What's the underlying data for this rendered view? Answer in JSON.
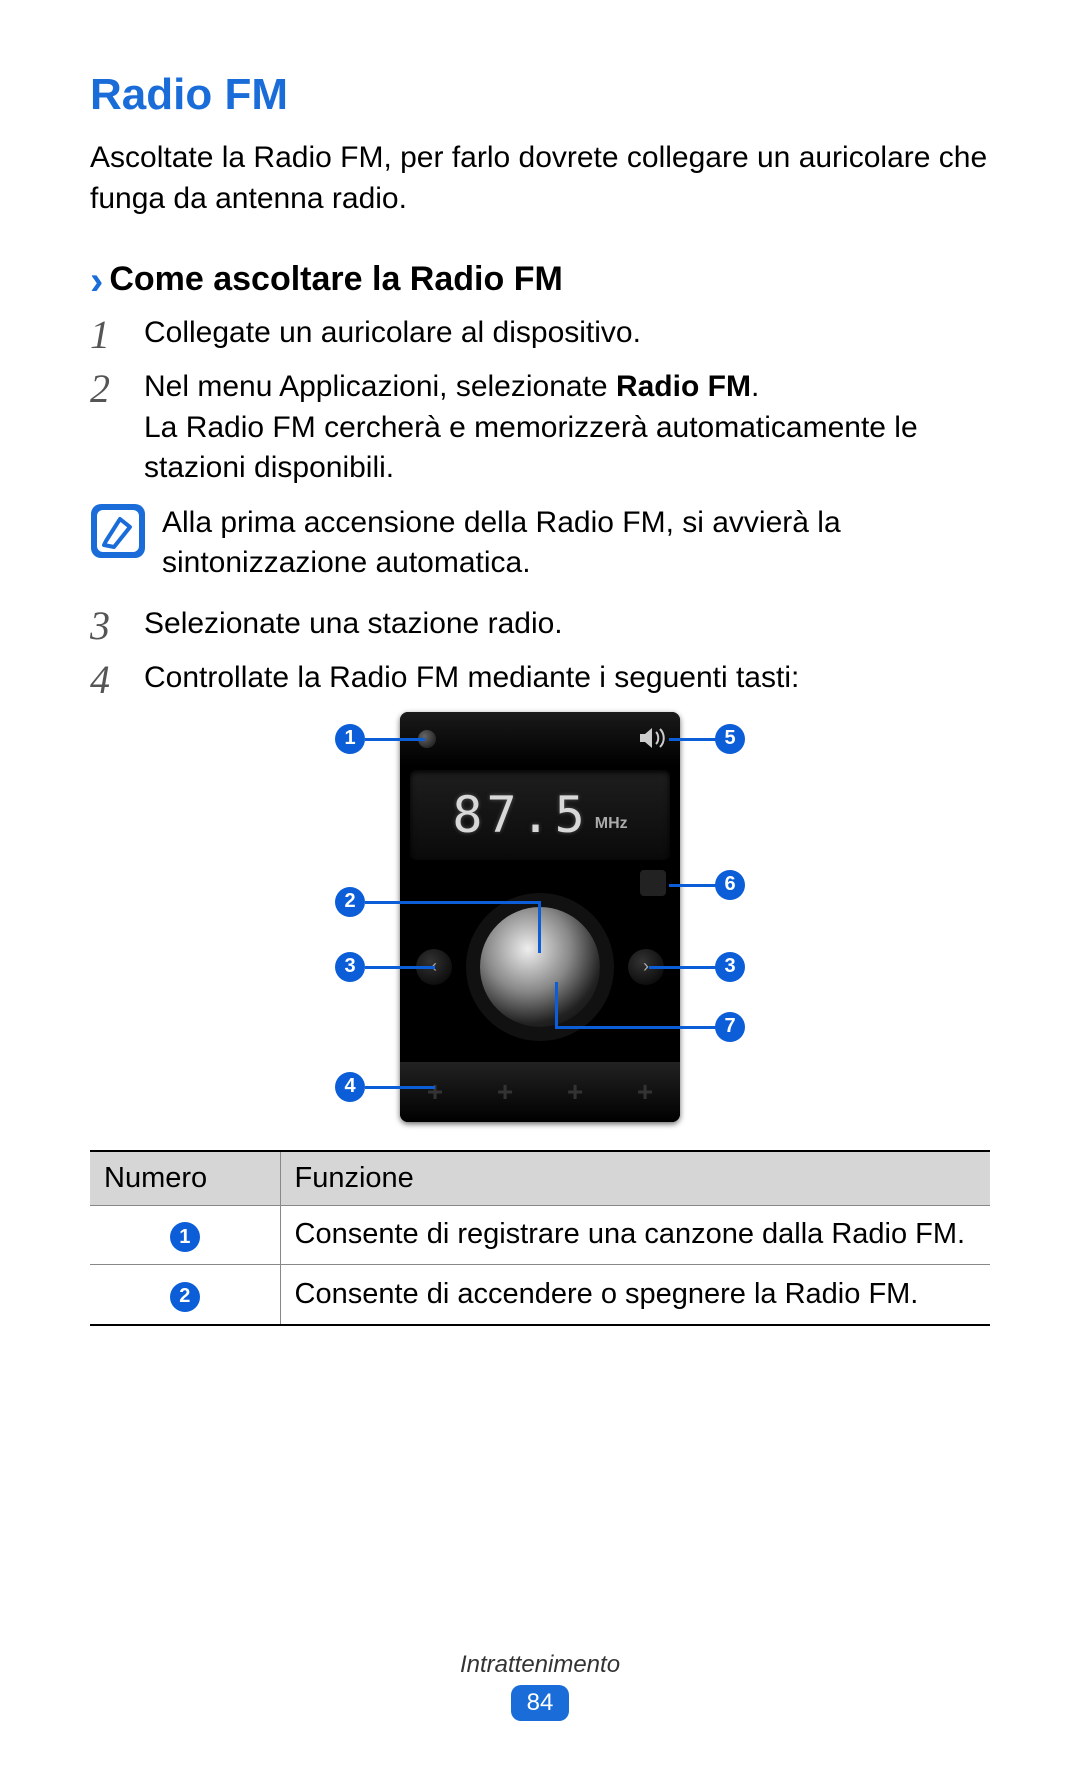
{
  "title": "Radio FM",
  "intro": "Ascoltate la Radio FM, per farlo dovrete collegare un auricolare che funga da antenna radio.",
  "subsection": {
    "chevron": "›",
    "title": "Come ascoltare la Radio FM"
  },
  "steps": {
    "s1": {
      "num": "1",
      "text": "Collegate un auricolare al dispositivo."
    },
    "s2": {
      "num": "2",
      "text_a": "Nel menu Applicazioni, selezionate ",
      "text_bold": "Radio FM",
      "text_b": ".",
      "text_c": "La Radio FM cercherà e memorizzerà automaticamente le stazioni disponibili."
    },
    "s3": {
      "num": "3",
      "text": "Selezionate una stazione radio."
    },
    "s4": {
      "num": "4",
      "text": "Controllate la Radio FM mediante i seguenti tasti:"
    }
  },
  "note": {
    "icon": "note-icon",
    "text": "Alla prima accensione della Radio FM, si avvierà la sintonizzazione automatica."
  },
  "diagram": {
    "frequency": "87.5",
    "unit": "MHz",
    "callouts": {
      "c1": "1",
      "c2": "2",
      "c3": "3",
      "c4": "4",
      "c5": "5",
      "c6": "6",
      "c7": "7"
    }
  },
  "table": {
    "header_num": "Numero",
    "header_func": "Funzione",
    "rows": [
      {
        "num": "1",
        "func": "Consente di registrare una canzone dalla Radio FM."
      },
      {
        "num": "2",
        "func": "Consente di accendere o spegnere la Radio FM."
      }
    ]
  },
  "footer": {
    "section": "Intrattenimento",
    "page": "84"
  }
}
